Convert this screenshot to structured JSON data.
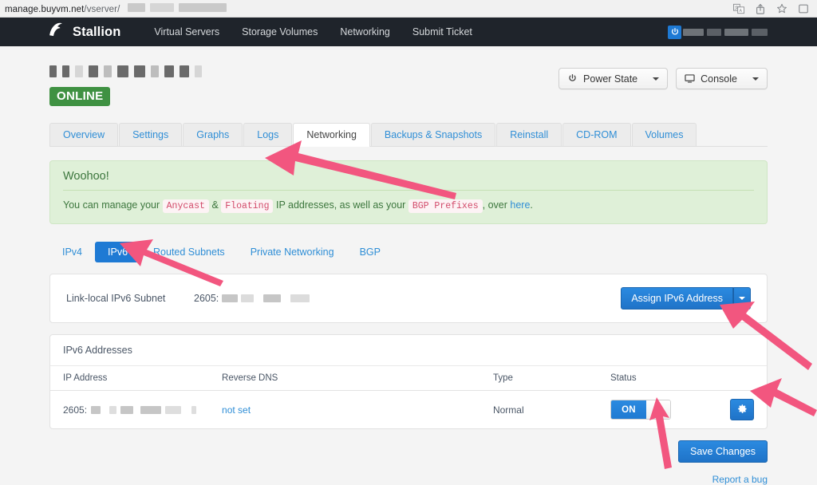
{
  "browser": {
    "url_domain": "manage.buyvm.net",
    "url_path": "/vserver/",
    "icons": [
      "translate-icon",
      "share-icon",
      "bookmark-star-icon",
      "tabs-icon"
    ]
  },
  "navbar": {
    "brand": "Stallion",
    "links": [
      "Virtual Servers",
      "Storage Volumes",
      "Networking",
      "Submit Ticket"
    ],
    "user_icon": "power-user-icon"
  },
  "server": {
    "status": "ONLINE",
    "actions": [
      {
        "label": "Power State",
        "icon": "power-icon",
        "has_caret": true
      },
      {
        "label": "Console",
        "icon": "monitor-icon",
        "has_caret": true
      }
    ]
  },
  "tabs": [
    {
      "label": "Overview",
      "active": false
    },
    {
      "label": "Settings",
      "active": false
    },
    {
      "label": "Graphs",
      "active": false
    },
    {
      "label": "Logs",
      "active": false
    },
    {
      "label": "Networking",
      "active": true
    },
    {
      "label": "Backups & Snapshots",
      "active": false
    },
    {
      "label": "Reinstall",
      "active": false
    },
    {
      "label": "CD-ROM",
      "active": false
    },
    {
      "label": "Volumes",
      "active": false
    }
  ],
  "alert": {
    "title": "Woohoo!",
    "text_1": "You can manage your",
    "code_1": "Anycast",
    "amp": "&",
    "code_2": "Floating",
    "text_2": "IP addresses, as well as your",
    "code_3": "BGP Prefixes",
    "text_3": ", over",
    "link": "here",
    "text_4": "."
  },
  "pills": [
    {
      "label": "IPv4",
      "active": false
    },
    {
      "label": "IPv6",
      "active": true
    },
    {
      "label": "Routed Subnets",
      "active": false
    },
    {
      "label": "Private Networking",
      "active": false
    },
    {
      "label": "BGP",
      "active": false
    }
  ],
  "linklocal": {
    "label": "Link-local IPv6 Subnet",
    "value_prefix": "2605:",
    "assign_button": "Assign IPv6 Address"
  },
  "table": {
    "panel_title": "IPv6 Addresses",
    "columns": [
      "IP Address",
      "Reverse DNS",
      "Type",
      "Status"
    ],
    "rows": [
      {
        "ip_prefix": "2605:",
        "reverse_dns": "not set",
        "type": "Normal",
        "status_toggle": "ON",
        "gear": "gear-icon"
      }
    ]
  },
  "footer": {
    "save_label": "Save Changes",
    "report_label": "Report a bug"
  },
  "colors": {
    "accent_blue": "#1e7ad4",
    "link_blue": "#2f8ed6",
    "status_green": "#3f9142",
    "alert_bg": "#dff0d8",
    "alert_text": "#3c763d",
    "code_pink": "#d24b6a",
    "navbar_dark": "#1f242b",
    "annotation_pink": "#f2567f"
  }
}
